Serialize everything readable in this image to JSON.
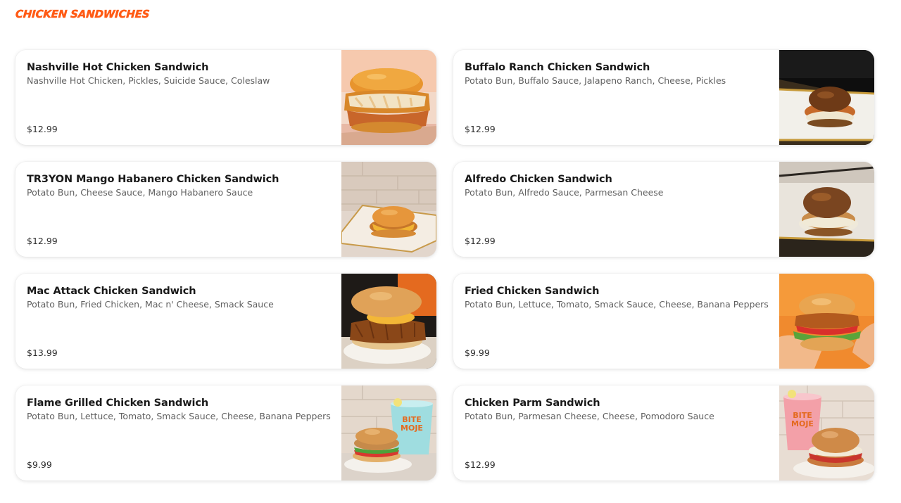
{
  "section": {
    "title": "CHICKEN SANDWICHES"
  },
  "items": [
    {
      "name": "Nashville Hot Chicken Sandwich",
      "description": "Nashville Hot Chicken, Pickles, Suicide Sauce, Coleslaw",
      "price": "$12.99",
      "image": "sandwich-photo"
    },
    {
      "name": "Buffalo Ranch Chicken Sandwich",
      "description": "Potato Bun, Buffalo Sauce, Jalapeno Ranch, Cheese, Pickles",
      "price": "$12.99",
      "image": "sandwich-photo"
    },
    {
      "name": "TR3YON Mango Habanero Chicken Sandwich",
      "description": "Potato Bun, Cheese Sauce, Mango Habanero Sauce",
      "price": "$12.99",
      "image": "sandwich-photo"
    },
    {
      "name": "Alfredo Chicken Sandwich",
      "description": "Potato Bun, Alfredo Sauce, Parmesan Cheese",
      "price": "$12.99",
      "image": "sandwich-photo"
    },
    {
      "name": "Mac Attack Chicken Sandwich",
      "description": "Potato Bun, Fried Chicken, Mac n' Cheese, Smack Sauce",
      "price": "$13.99",
      "image": "sandwich-photo"
    },
    {
      "name": "Fried Chicken Sandwich",
      "description": "Potato Bun, Lettuce, Tomato, Smack Sauce, Cheese, Banana Peppers",
      "price": "$9.99",
      "image": "sandwich-photo"
    },
    {
      "name": "Flame Grilled Chicken Sandwich",
      "description": "Potato Bun, Lettuce, Tomato, Smack Sauce, Cheese, Banana Peppers",
      "price": "$9.99",
      "image": "sandwich-photo"
    },
    {
      "name": "Chicken Parm Sandwich",
      "description": "Potato Bun, Parmesan Cheese, Cheese, Pomodoro Sauce",
      "price": "$12.99",
      "image": "sandwich-photo"
    }
  ],
  "colors": {
    "accent": "#ff5a14",
    "name_text": "#191919",
    "desc_text": "#606060",
    "price_text": "#2c2c2c"
  }
}
